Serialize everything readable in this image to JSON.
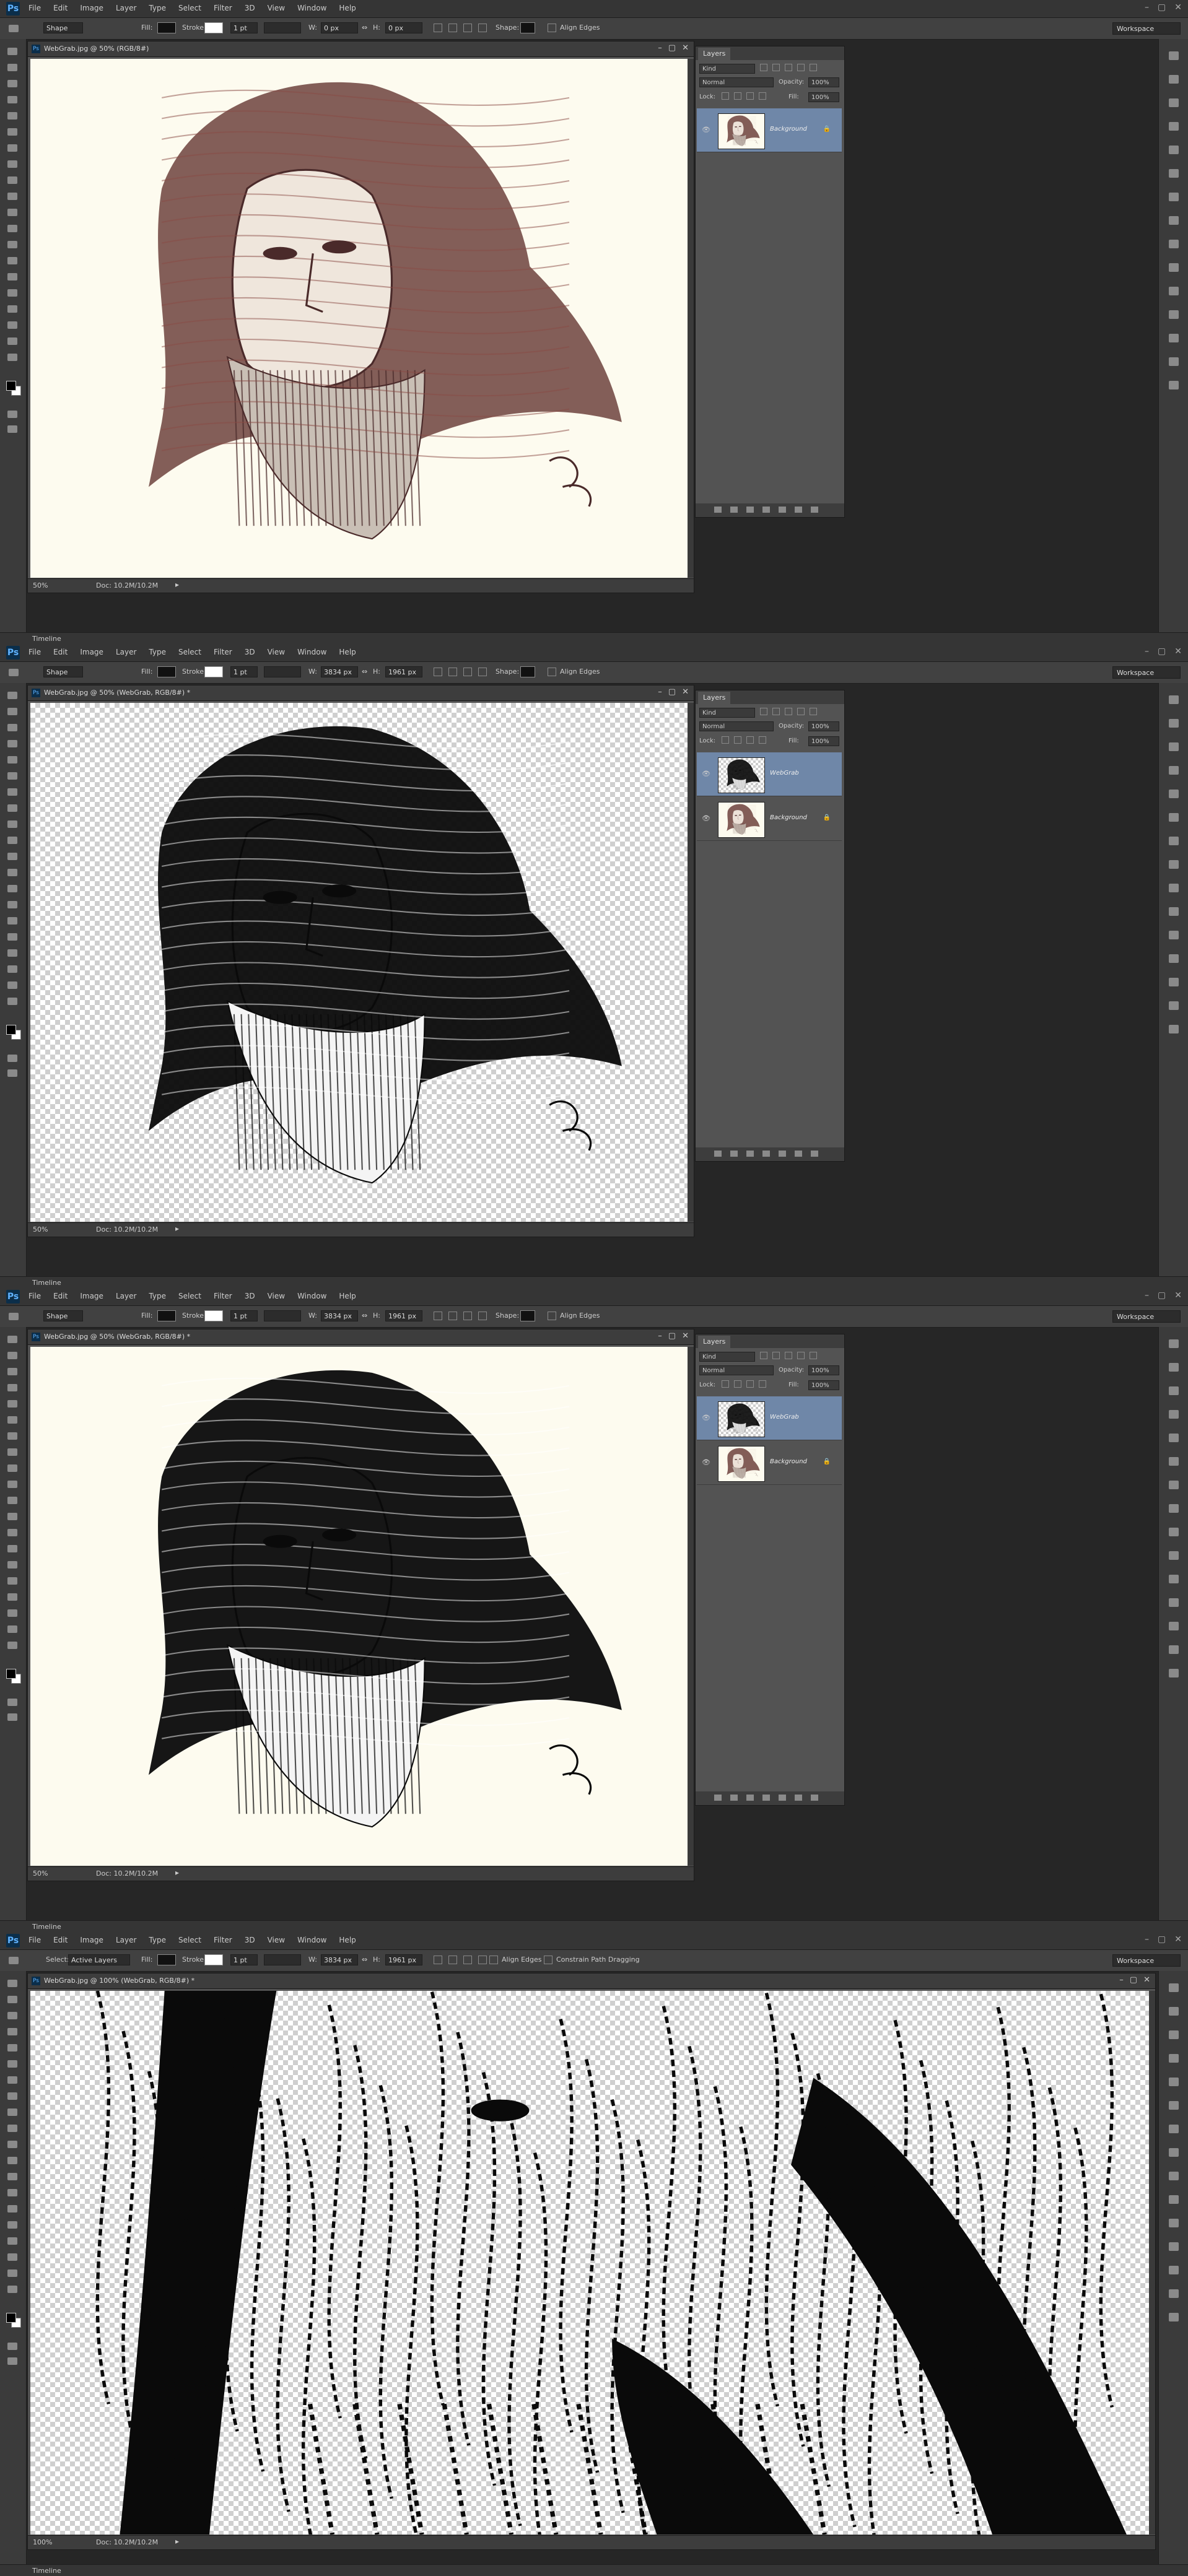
{
  "app": {
    "logo": "Ps",
    "menus": [
      "File",
      "Edit",
      "Image",
      "Layer",
      "Type",
      "Select",
      "Filter",
      "3D",
      "View",
      "Window",
      "Help"
    ],
    "window_controls": [
      "–",
      "▢",
      "✕"
    ],
    "workspace": "Workspace",
    "timeline_label": "Timeline"
  },
  "panels": [
    {
      "doc_title": "WebGrab.jpg @ 50% (RGB/8#)",
      "options": {
        "tool_mode": "Shape",
        "fill": "Fill:",
        "stroke": "Stroke:",
        "stroke_size": "1 pt",
        "w": "0 px",
        "h": "0 px",
        "shape": "Shape:",
        "align_edges": "Align Edges"
      },
      "zoom": "50%",
      "doc_info": "Doc: 10.2M/10.2M",
      "layers": [
        {
          "name": "Background",
          "selected": true,
          "type": "photo"
        }
      ]
    },
    {
      "doc_title": "WebGrab.jpg @ 50% (WebGrab, RGB/8#) *",
      "options": {
        "tool_mode": "Shape",
        "fill": "Fill:",
        "stroke": "Stroke:",
        "stroke_size": "1 pt",
        "w": "3834 px",
        "h": "1961 px",
        "shape": "Shape:",
        "align_edges": "Align Edges"
      },
      "zoom": "50%",
      "doc_info": "Doc: 10.2M/10.2M",
      "layers": [
        {
          "name": "WebGrab",
          "selected": true,
          "type": "ink"
        },
        {
          "name": "Background",
          "selected": false,
          "type": "photo"
        }
      ]
    },
    {
      "doc_title": "WebGrab.jpg @ 50% (WebGrab, RGB/8#) *",
      "options": {
        "tool_mode": "Shape",
        "fill": "Fill:",
        "stroke": "Stroke:",
        "stroke_size": "1 pt",
        "w": "3834 px",
        "h": "1961 px",
        "shape": "Shape:",
        "align_edges": "Align Edges"
      },
      "zoom": "50%",
      "doc_info": "Doc: 10.2M/10.2M",
      "layers": [
        {
          "name": "WebGrab",
          "selected": true,
          "type": "ink"
        },
        {
          "name": "Background",
          "selected": false,
          "type": "photo"
        }
      ]
    },
    {
      "doc_title": "WebGrab.jpg @ 100% (WebGrab, RGB/8#) *",
      "options": {
        "tool_mode": "Select:",
        "select_value": "Active Layers",
        "fill": "Fill:",
        "stroke": "Stroke:",
        "stroke_size": "1 pt",
        "w": "3834 px",
        "h": "1961 px",
        "align_edges": "Align Edges",
        "constrain": "Constrain Path Dragging"
      },
      "zoom": "100%",
      "doc_info": "Doc: 10.2M/10.2M",
      "layers": []
    }
  ],
  "layers_panel": {
    "tab": "Layers",
    "kind": "Kind",
    "blend": "Normal",
    "opacity_label": "Opacity:",
    "opacity_value": "100%",
    "lock_label": "Lock:",
    "fill_label": "Fill:",
    "fill_value": "100%"
  }
}
